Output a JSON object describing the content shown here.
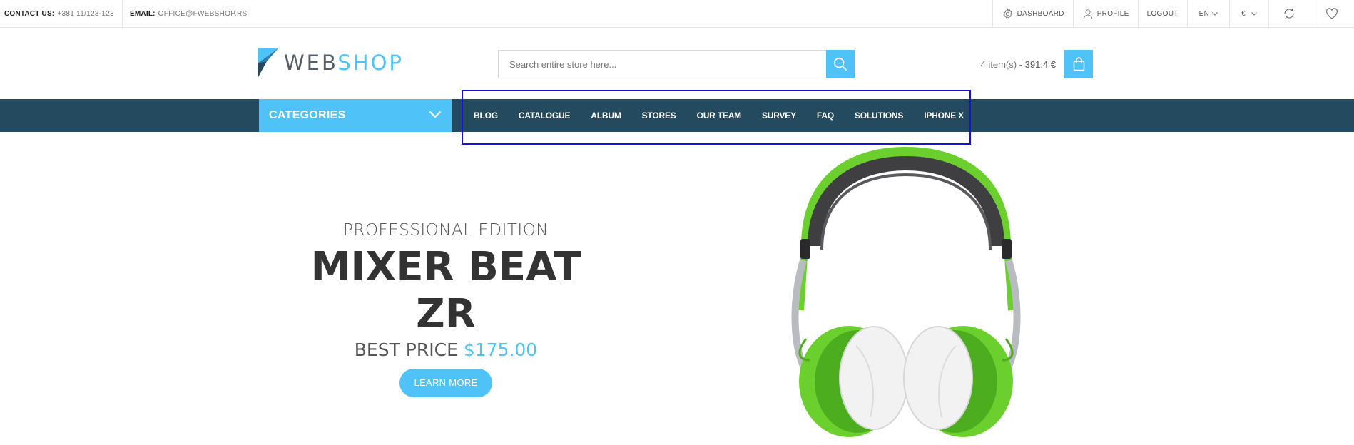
{
  "topbar": {
    "contact_label": "CONTACT US:",
    "contact_value": "+381 11/123-123",
    "email_label": "EMAIL:",
    "email_value": "OFFICE@FWEBSHOP.RS",
    "dashboard": "DASHBOARD",
    "profile": "PROFILE",
    "logout": "LOGOUT",
    "language": "EN",
    "currency": "€",
    "icons": [
      "gear-icon",
      "user-icon",
      "refresh-icon",
      "heart-icon"
    ]
  },
  "header": {
    "logo_web": "WEB",
    "logo_shop": "SHOP",
    "search_placeholder": "Search entire store here...",
    "cart_count": "4 item(s)",
    "cart_separator": " - ",
    "cart_total": "391.4 €"
  },
  "nav": {
    "categories_label": "CATEGORIES",
    "links": [
      "BLOG",
      "CATALOGUE",
      "ALBUM",
      "STORES",
      "OUR TEAM",
      "SURVEY",
      "FAQ",
      "SOLUTIONS",
      "IPHONE X"
    ]
  },
  "hero": {
    "subtitle": "PROFESSIONAL EDITION",
    "title": "MIXER BEAT ZR",
    "price_label": "BEST PRICE",
    "price_value": "$175.00",
    "button": "LEARN MORE"
  },
  "colors": {
    "accent": "#4fc3f7",
    "nav_bg": "#234a5e",
    "highlight_border": "#1414d4"
  }
}
